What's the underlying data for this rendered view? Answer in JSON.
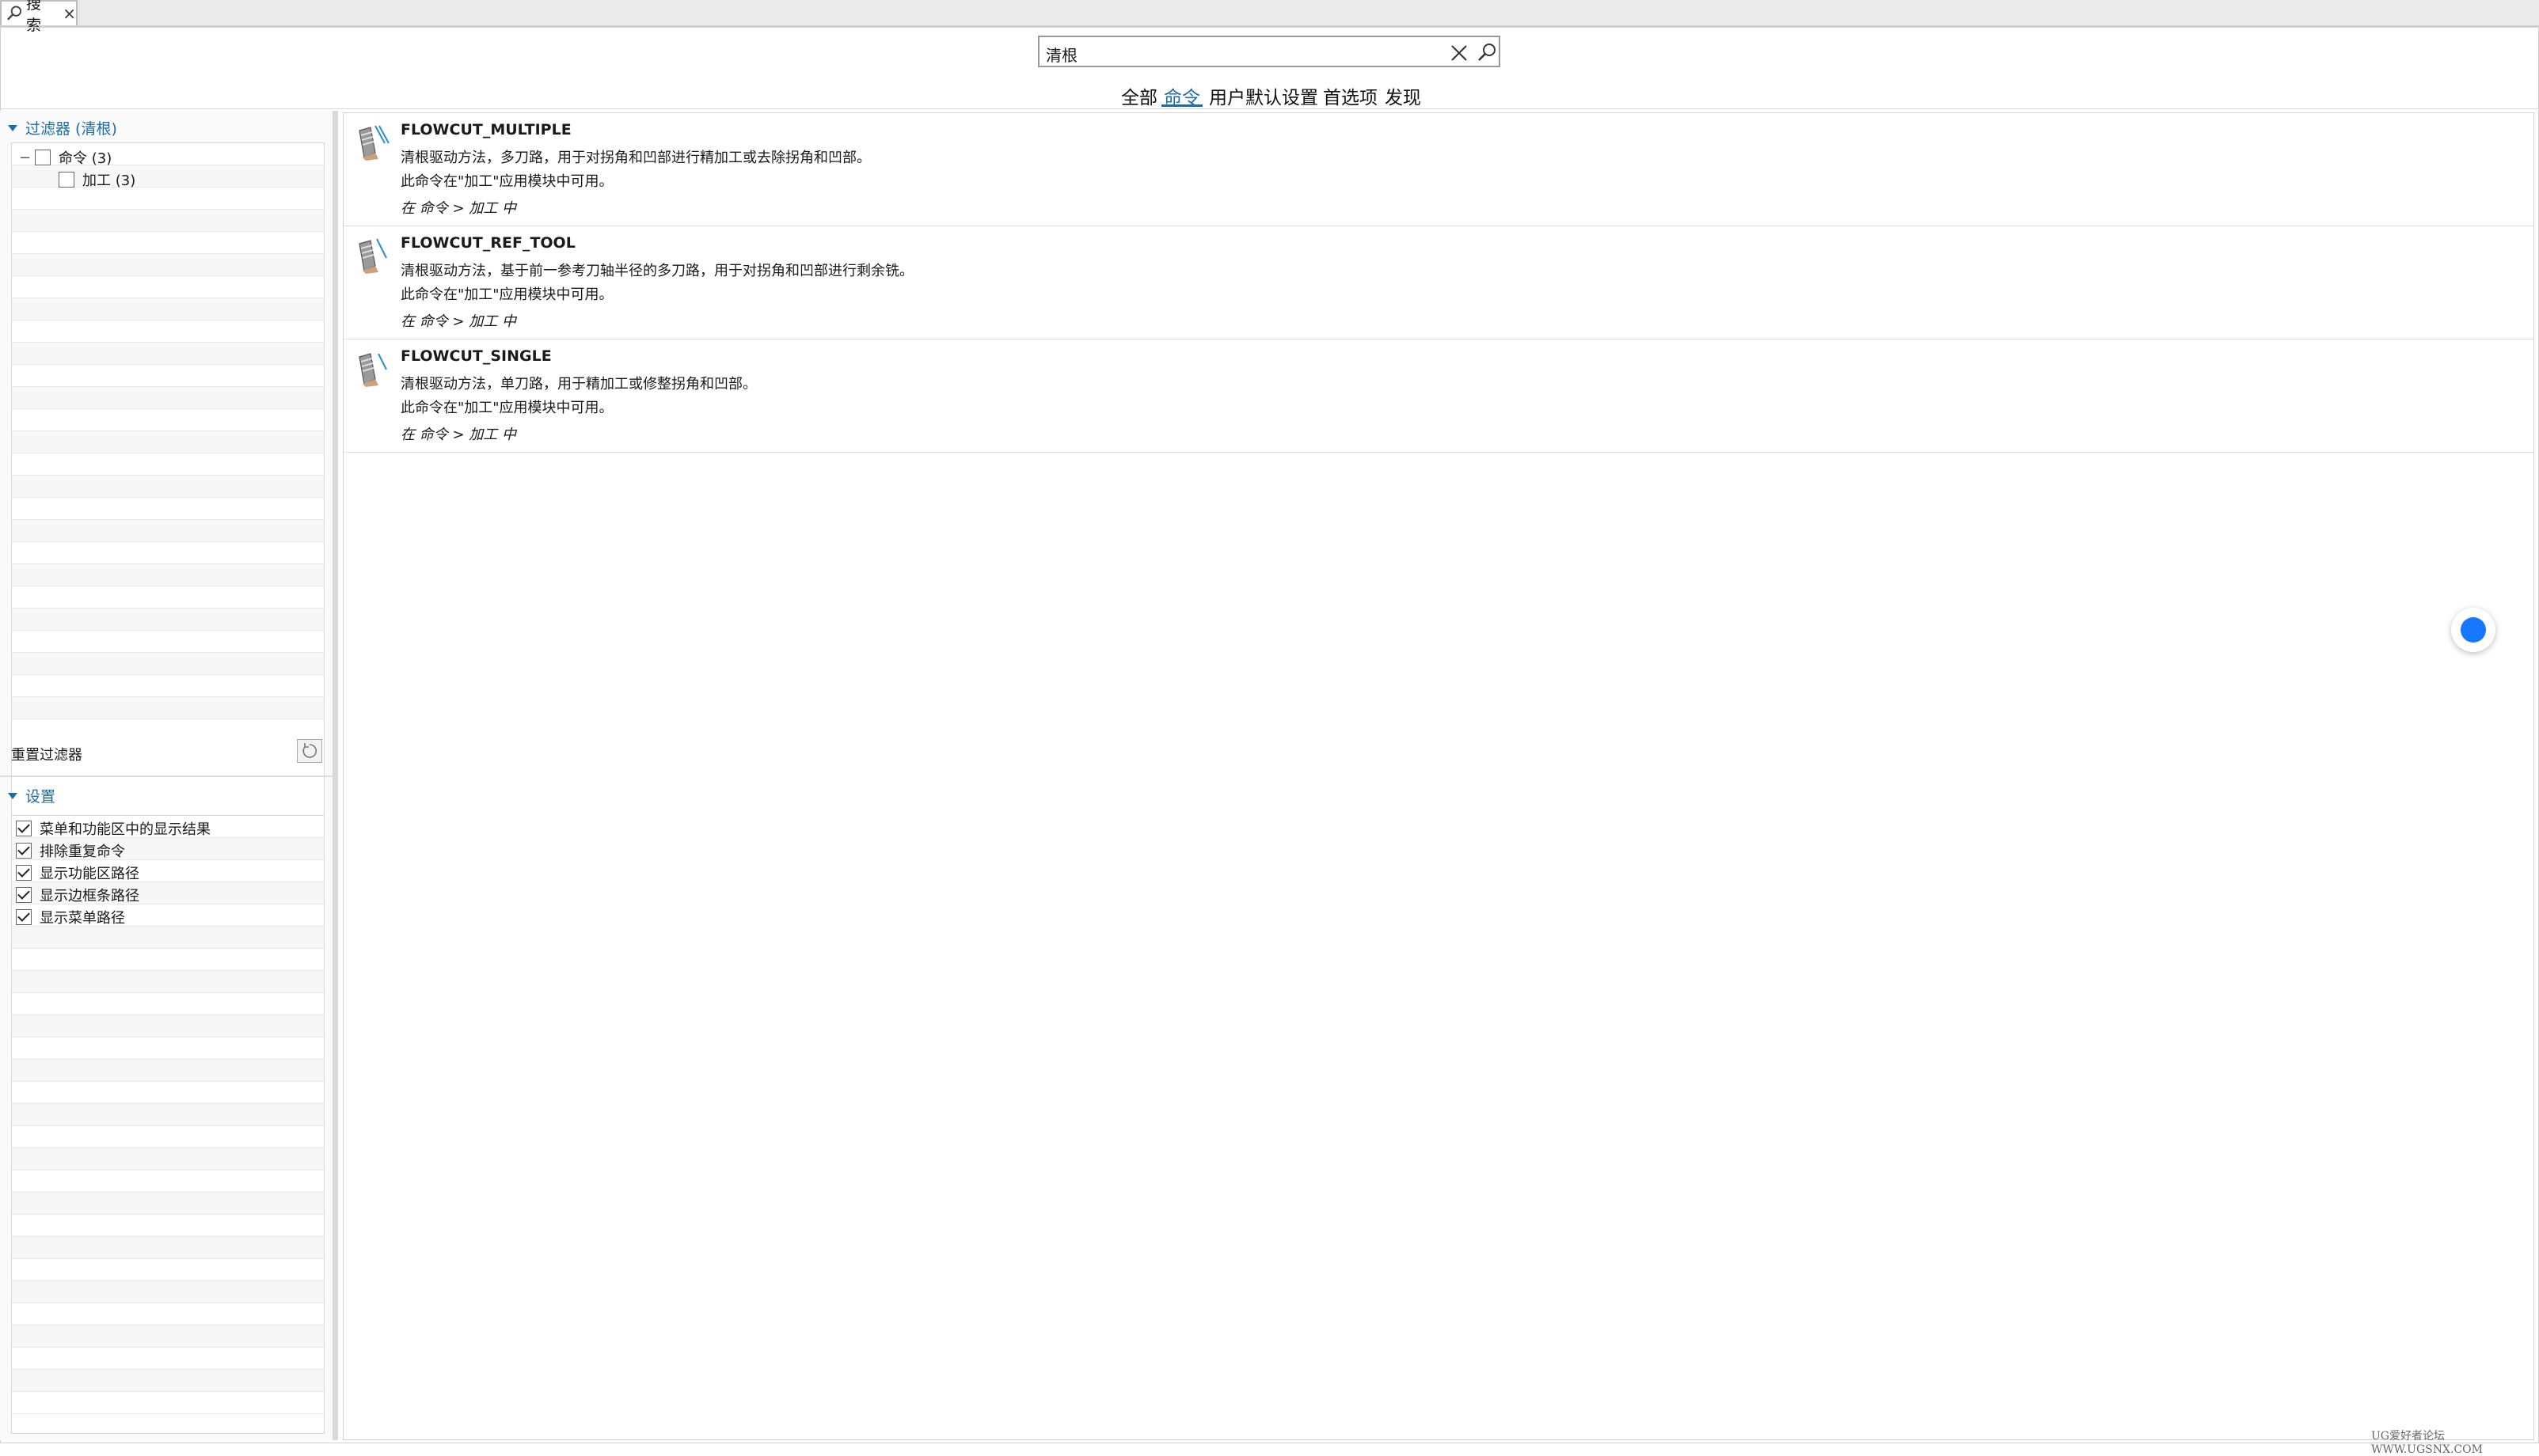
{
  "tab": {
    "label": "搜索",
    "close": "×",
    "icon": "search-icon"
  },
  "search": {
    "value": "清根",
    "clear_icon": "clear-icon",
    "search_icon": "search-icon"
  },
  "categories": [
    {
      "label": "全部",
      "active": false
    },
    {
      "label": "命令",
      "active": true
    },
    {
      "label": "用户默认设置",
      "active": false
    },
    {
      "label": "首选项",
      "active": false
    },
    {
      "label": "发现",
      "active": false
    }
  ],
  "filter": {
    "title": "过滤器 (清根)",
    "items": [
      {
        "label": "命令 (3)",
        "checked": false,
        "expander": "−"
      },
      {
        "label": "加工 (3)",
        "checked": false
      }
    ],
    "reset_label": "重置过滤器",
    "reset_icon": "reset-icon"
  },
  "settings": {
    "title": "设置",
    "items": [
      {
        "label": "菜单和功能区中的显示结果",
        "checked": true
      },
      {
        "label": "排除重复命令",
        "checked": true
      },
      {
        "label": "显示功能区路径",
        "checked": true
      },
      {
        "label": "显示边框条路径",
        "checked": true
      },
      {
        "label": "显示菜单路径",
        "checked": true
      }
    ]
  },
  "results": [
    {
      "title": "FLOWCUT_MULTIPLE",
      "desc": "清根驱动方法，多刀路，用于对拐角和凹部进行精加工或去除拐角和凹部。",
      "availability": "此命令在\"加工\"应用模块中可用。",
      "path": "在 命令 > 加工 中",
      "icon": "flowcut-multiple-icon"
    },
    {
      "title": "FLOWCUT_REF_TOOL",
      "desc": "清根驱动方法，基于前一参考刀轴半径的多刀路，用于对拐角和凹部进行剩余铣。",
      "availability": "此命令在\"加工\"应用模块中可用。",
      "path": "在 命令 > 加工 中",
      "icon": "flowcut-ref-tool-icon"
    },
    {
      "title": "FLOWCUT_SINGLE",
      "desc": "清根驱动方法，单刀路，用于精加工或修整拐角和凹部。",
      "availability": "此命令在\"加工\"应用模块中可用。",
      "path": "在 命令 > 加工 中",
      "icon": "flowcut-single-icon"
    }
  ],
  "watermark": "UG爱好者论坛 WWW.UGSNX.COM",
  "colors": {
    "accent": "#1d6ea8",
    "float_button": "#1677ff"
  }
}
